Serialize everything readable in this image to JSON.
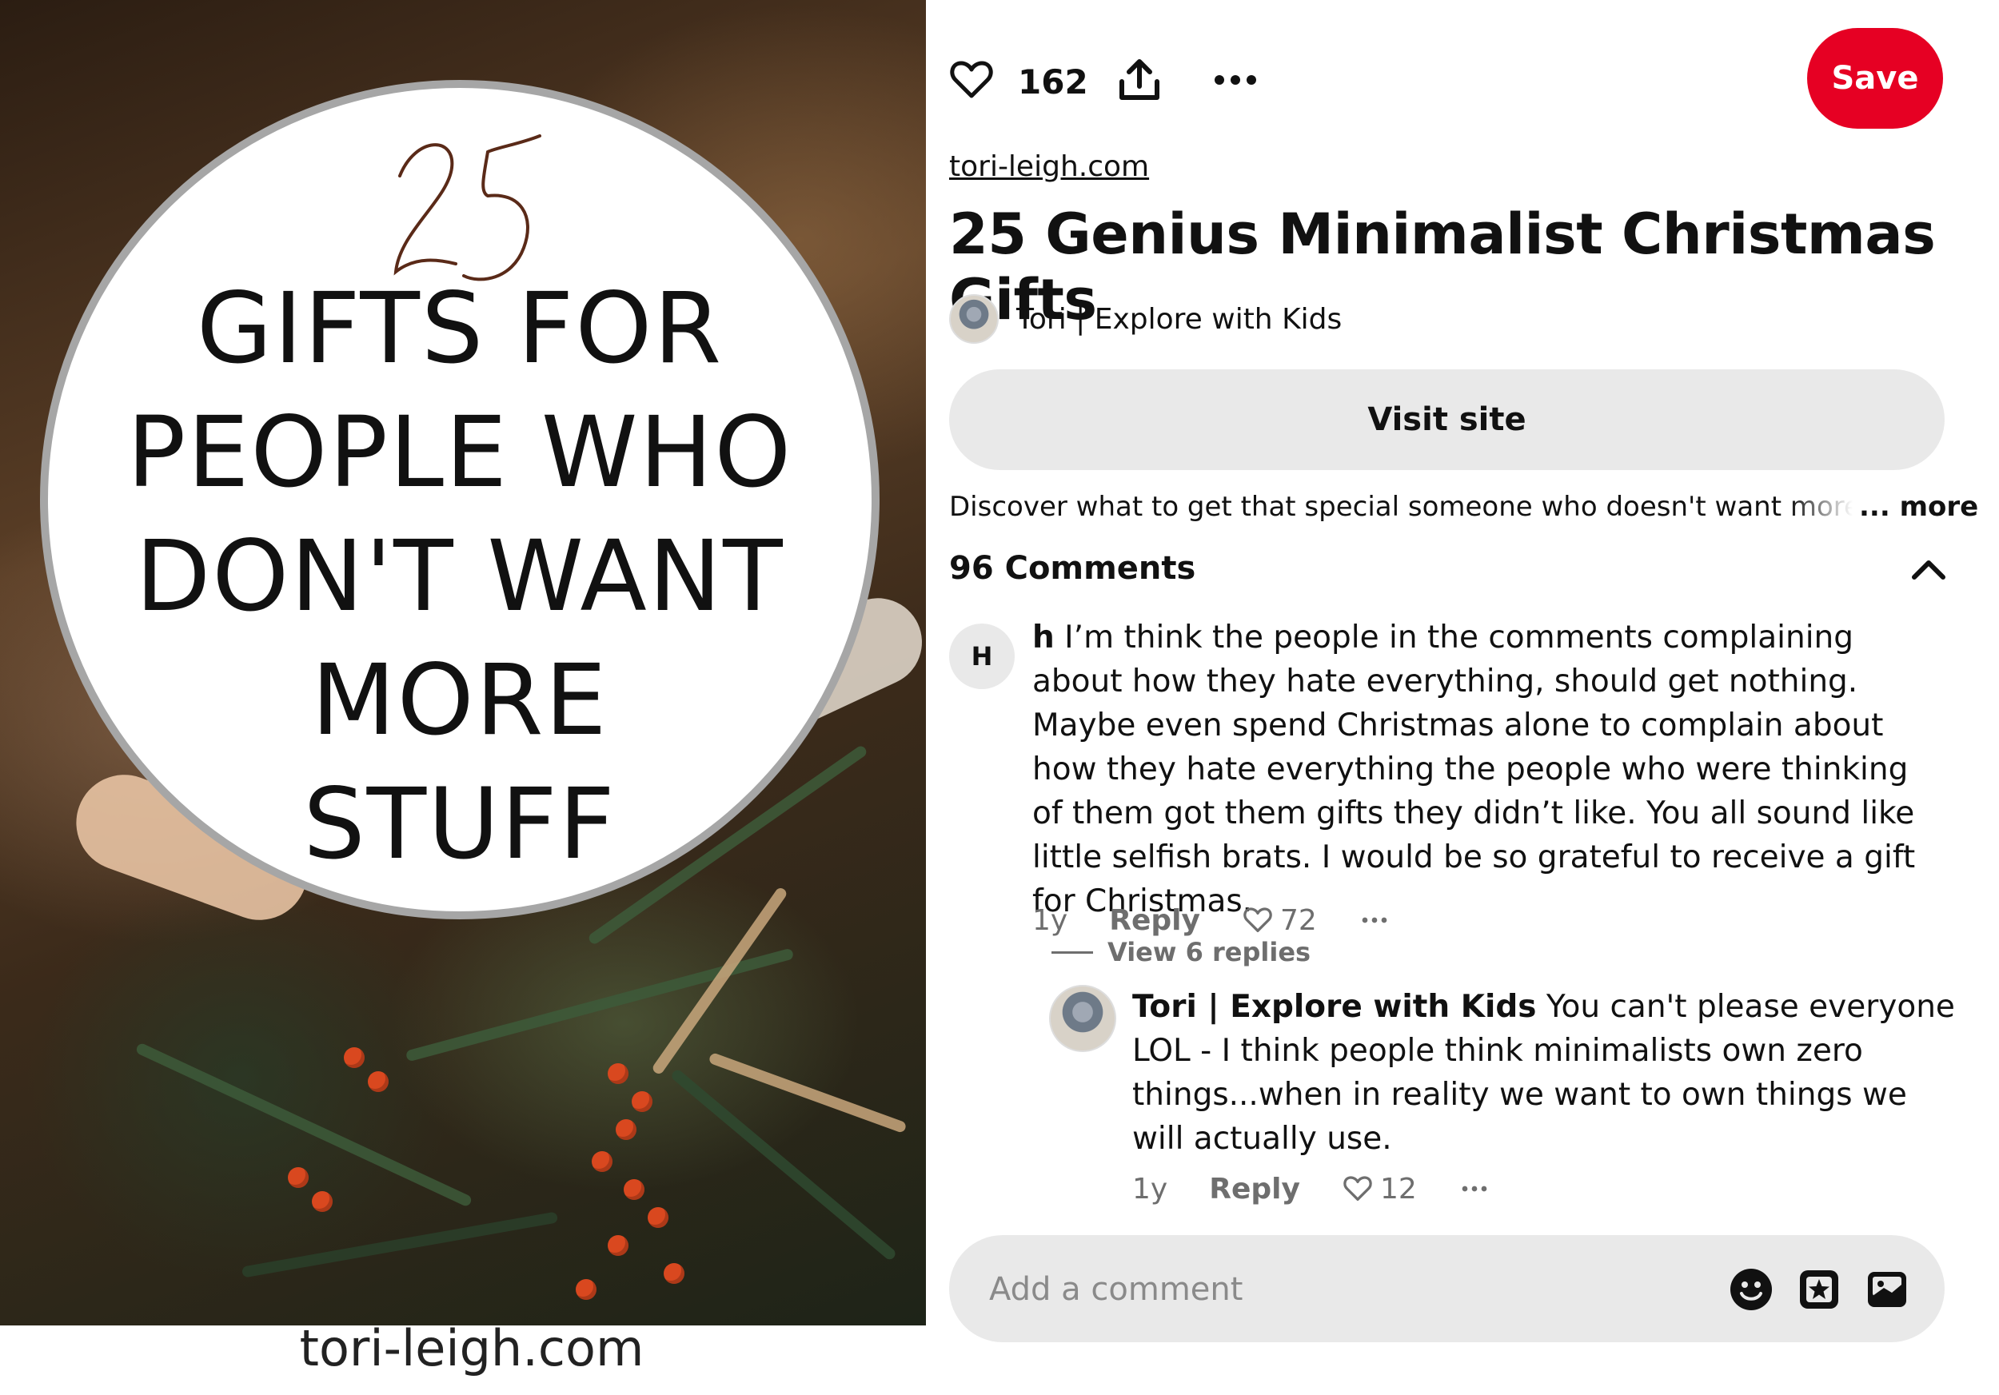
{
  "pin_image": {
    "circle_number": "25",
    "circle_lines": [
      "GIFTS FOR",
      "PEOPLE WHO",
      "DON'T WANT",
      "MORE",
      "STUFF"
    ],
    "footer_text": "tori-leigh.com"
  },
  "toolbar": {
    "reaction_icon": "heart-icon",
    "reaction_count": "162",
    "share_icon": "share-icon",
    "more_icon": "ellipsis-icon",
    "save_label": "Save"
  },
  "pin": {
    "source": "tori-leigh.com",
    "title": "25 Genius Minimalist Christmas Gifts",
    "author": "Tori | Explore with Kids",
    "visit_label": "Visit site",
    "description": "Discover what to get that special someone who doesn't want more stuff",
    "description_more": "... more"
  },
  "comments": {
    "header": "96 Comments",
    "collapse_icon": "chevron-up-icon",
    "items": [
      {
        "avatar_letter": "H",
        "author": "h",
        "text": "I’m think the people in the comments complaining about how they hate everything, should get nothing. Maybe even spend Christmas alone to complain about how they hate everything the people who were thinking of them got them gifts they didn’t like. You all sound like little selfish brats. I would be so grateful to receive a gift for Christmas.",
        "age": "1y",
        "reply_label": "Reply",
        "likes": "72",
        "view_replies": "View 6 replies"
      }
    ],
    "reply": {
      "author": "Tori | Explore with Kids",
      "text": "You can't please everyone LOL - I think people think minimalists own zero things...when in reality we want to own things we will actually use.",
      "age": "1y",
      "reply_label": "Reply",
      "likes": "12"
    }
  },
  "comment_box": {
    "placeholder": "Add a comment",
    "icons": [
      "emoji-icon",
      "sticker-icon",
      "image-icon"
    ]
  },
  "colors": {
    "save_red": "#e60023",
    "button_gray": "#e9e9e9",
    "muted_text": "#6e6e6e"
  }
}
